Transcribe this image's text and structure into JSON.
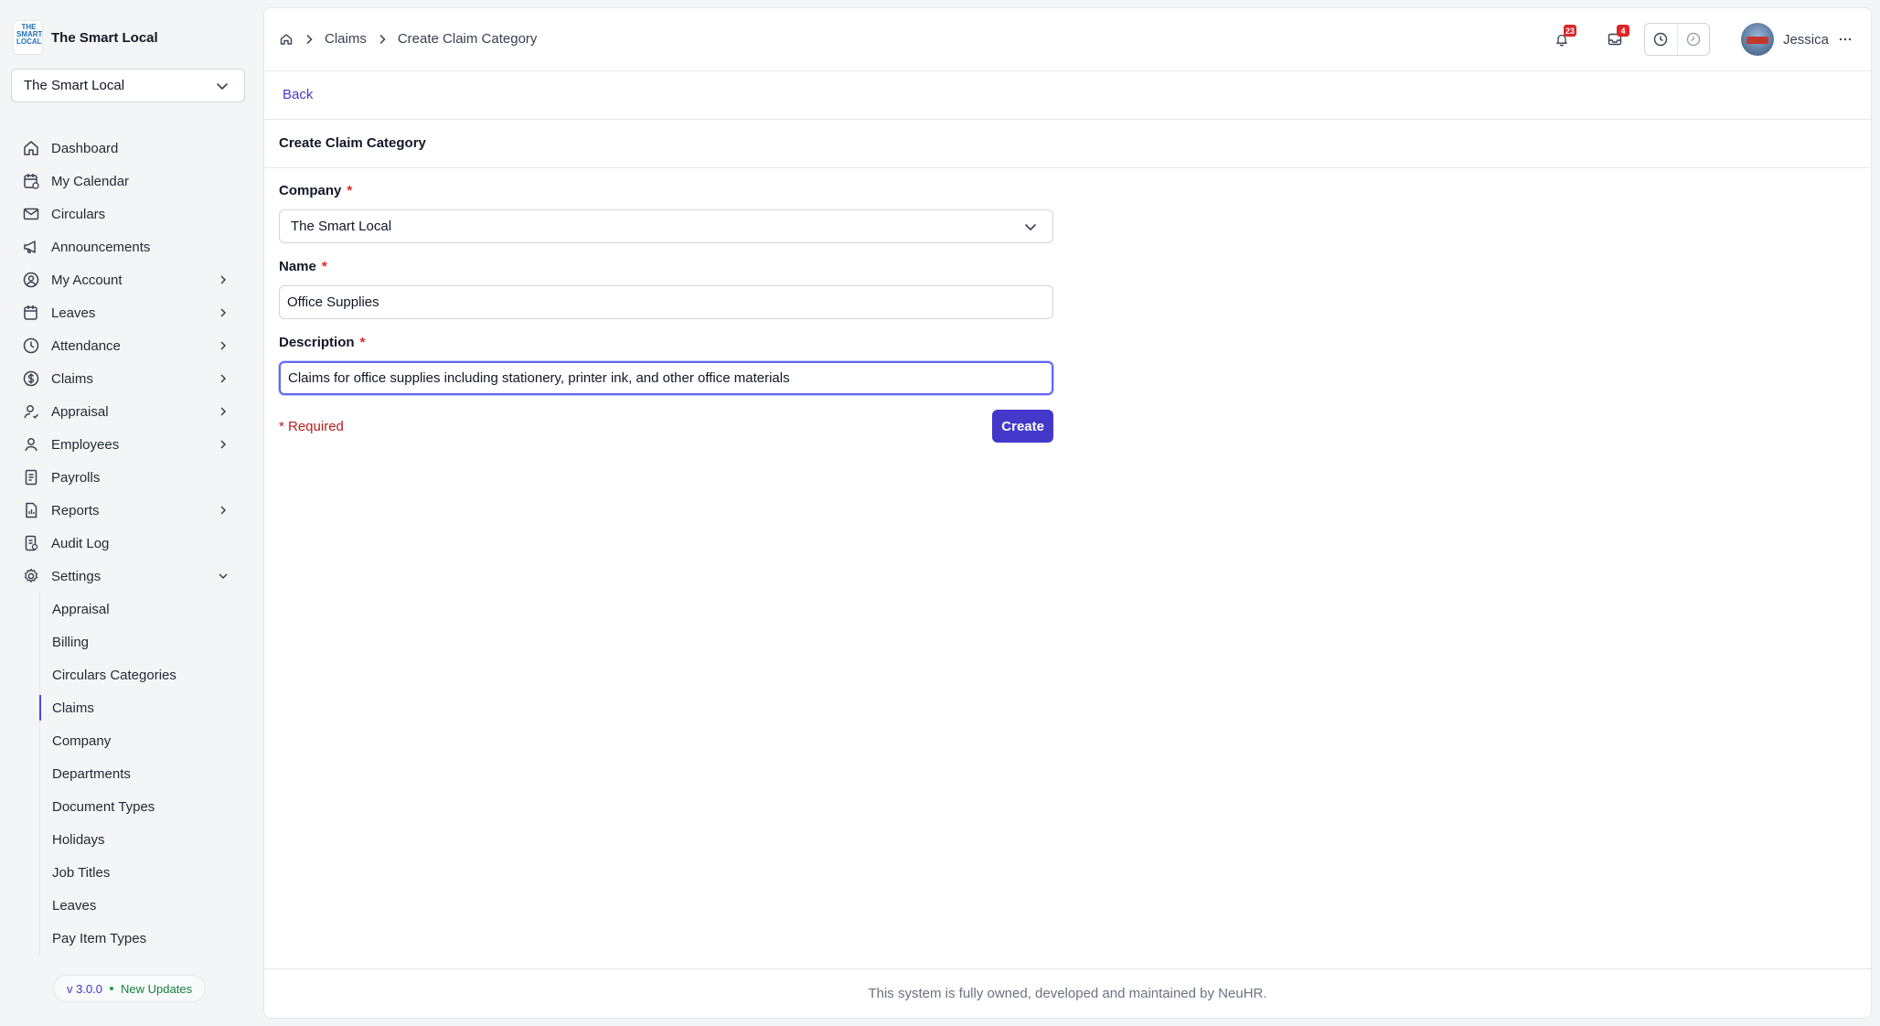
{
  "brand": {
    "name": "The Smart Local",
    "logo_text": "THE SMART LOCAL"
  },
  "company_switcher": {
    "value": "The Smart Local"
  },
  "sidebar": {
    "items": [
      {
        "label": "Dashboard",
        "icon": "home-icon",
        "has_chevron": false
      },
      {
        "label": "My Calendar",
        "icon": "calendar-icon",
        "has_chevron": false
      },
      {
        "label": "Circulars",
        "icon": "mail-icon",
        "has_chevron": false
      },
      {
        "label": "Announcements",
        "icon": "megaphone-icon",
        "has_chevron": false
      },
      {
        "label": "My Account",
        "icon": "user-circle-icon",
        "has_chevron": true
      },
      {
        "label": "Leaves",
        "icon": "calendar-leave-icon",
        "has_chevron": true
      },
      {
        "label": "Attendance",
        "icon": "clock-icon",
        "has_chevron": true
      },
      {
        "label": "Claims",
        "icon": "dollar-circle-icon",
        "has_chevron": true
      },
      {
        "label": "Appraisal",
        "icon": "user-check-icon",
        "has_chevron": true
      },
      {
        "label": "Employees",
        "icon": "user-icon",
        "has_chevron": true
      },
      {
        "label": "Payrolls",
        "icon": "receipt-icon",
        "has_chevron": false
      },
      {
        "label": "Reports",
        "icon": "report-icon",
        "has_chevron": true
      },
      {
        "label": "Audit Log",
        "icon": "audit-icon",
        "has_chevron": false
      },
      {
        "label": "Settings",
        "icon": "gear-icon",
        "has_chevron": true,
        "expanded": true
      }
    ],
    "settings_children": [
      "Appraisal",
      "Billing",
      "Circulars Categories",
      "Claims",
      "Company",
      "Departments",
      "Document Types",
      "Holidays",
      "Job Titles",
      "Leaves",
      "Pay Item Types"
    ],
    "active_child": "Claims"
  },
  "version": {
    "number": "v 3.0.0",
    "updates": "New Updates"
  },
  "breadcrumb": {
    "items": [
      "Claims",
      "Create Claim Category"
    ]
  },
  "topbar": {
    "notifications_count": "23",
    "inbox_count": "4",
    "user_name": "Jessica"
  },
  "page": {
    "back_label": "Back",
    "title": "Create Claim Category"
  },
  "form": {
    "company": {
      "label": "Company",
      "value": "The Smart Local"
    },
    "name": {
      "label": "Name",
      "value": "Office Supplies"
    },
    "description": {
      "label": "Description",
      "value": "Claims for office supplies including stationery, printer ink, and other office materials"
    },
    "required_star": "*",
    "required_note": "* Required",
    "submit_label": "Create"
  },
  "footer": {
    "text": "This system is fully owned, developed and maintained by NeuHR."
  },
  "colors": {
    "accent": "#4338ca",
    "danger": "#dc2626",
    "focus": "#6366f1"
  }
}
